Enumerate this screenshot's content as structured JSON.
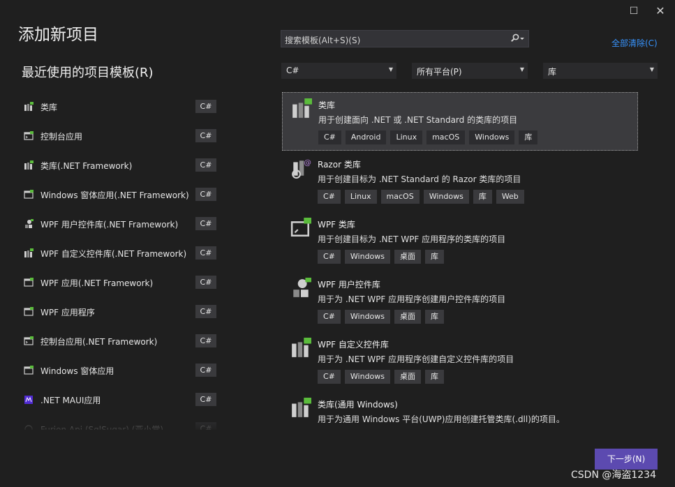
{
  "window": {
    "maximize_glyph": "☐",
    "close_glyph": "✕"
  },
  "title": "添加新项目",
  "recent_title": "最近使用的项目模板(R)",
  "search": {
    "placeholder": "搜索模板(Alt+S)(S)",
    "icon": "search-icon"
  },
  "clear_all": "全部清除(C)",
  "filters": {
    "language": "C#",
    "platform": "所有平台(P)",
    "project_type": "库"
  },
  "recent_items": [
    {
      "name": "类库",
      "lang": "C#",
      "icon": "class-library-icon"
    },
    {
      "name": "控制台应用",
      "lang": "C#",
      "icon": "console-app-icon"
    },
    {
      "name": "类库(.NET Framework)",
      "lang": "C#",
      "icon": "class-library-icon"
    },
    {
      "name": "Windows 窗体应用(.NET Framework)",
      "lang": "C#",
      "icon": "windows-forms-icon"
    },
    {
      "name": "WPF 用户控件库(.NET Framework)",
      "lang": "C#",
      "icon": "wpf-user-control-icon"
    },
    {
      "name": "WPF 自定义控件库(.NET Framework)",
      "lang": "C#",
      "icon": "wpf-custom-control-icon"
    },
    {
      "name": "WPF 应用(.NET Framework)",
      "lang": "C#",
      "icon": "wpf-app-icon"
    },
    {
      "name": "WPF 应用程序",
      "lang": "C#",
      "icon": "wpf-app-icon"
    },
    {
      "name": "控制台应用(.NET Framework)",
      "lang": "C#",
      "icon": "console-app-icon"
    },
    {
      "name": "Windows 窗体应用",
      "lang": "C#",
      "icon": "windows-forms-icon"
    },
    {
      "name": ".NET MAUI应用",
      "lang": "C#",
      "icon": "maui-app-icon"
    },
    {
      "name": "Furion Api (SqlSugar) (亚小常)",
      "lang": "C#",
      "icon": "web-api-icon"
    }
  ],
  "templates": [
    {
      "name": "类库",
      "desc": "用于创建面向 .NET 或 .NET Standard 的类库的项目",
      "tags": [
        "C#",
        "Android",
        "Linux",
        "macOS",
        "Windows",
        "库"
      ],
      "icon": "class-library-icon"
    },
    {
      "name": "Razor 类库",
      "desc": "用于创建目标为 .NET Standard 的 Razor 类库的项目",
      "tags": [
        "C#",
        "Linux",
        "macOS",
        "Windows",
        "库",
        "Web"
      ],
      "icon": "razor-library-icon"
    },
    {
      "name": "WPF 类库",
      "desc": "用于创建目标为 .NET WPF 应用程序的类库的项目",
      "tags": [
        "C#",
        "Windows",
        "桌面",
        "库"
      ],
      "icon": "wpf-library-icon"
    },
    {
      "name": "WPF 用户控件库",
      "desc": "用于为 .NET WPF 应用程序创建用户控件库的项目",
      "tags": [
        "C#",
        "Windows",
        "桌面",
        "库"
      ],
      "icon": "wpf-user-control-icon"
    },
    {
      "name": "WPF 自定义控件库",
      "desc": "用于为 .NET WPF 应用程序创建自定义控件库的项目",
      "tags": [
        "C#",
        "Windows",
        "桌面",
        "库"
      ],
      "icon": "wpf-custom-control-icon"
    },
    {
      "name": "类库(通用 Windows)",
      "desc": "用于为通用 Windows 平台(UWP)应用创建托管类库(.dll)的项目。",
      "tags": [],
      "icon": "uwp-library-icon"
    }
  ],
  "next_button": "下一步(N)",
  "watermark": "CSDN @海盗1234",
  "colors": {
    "background": "#1f1f1f",
    "accent_button": "#5c4ab0",
    "link": "#3794ff",
    "csharp_badge": "#5bbc3c"
  }
}
